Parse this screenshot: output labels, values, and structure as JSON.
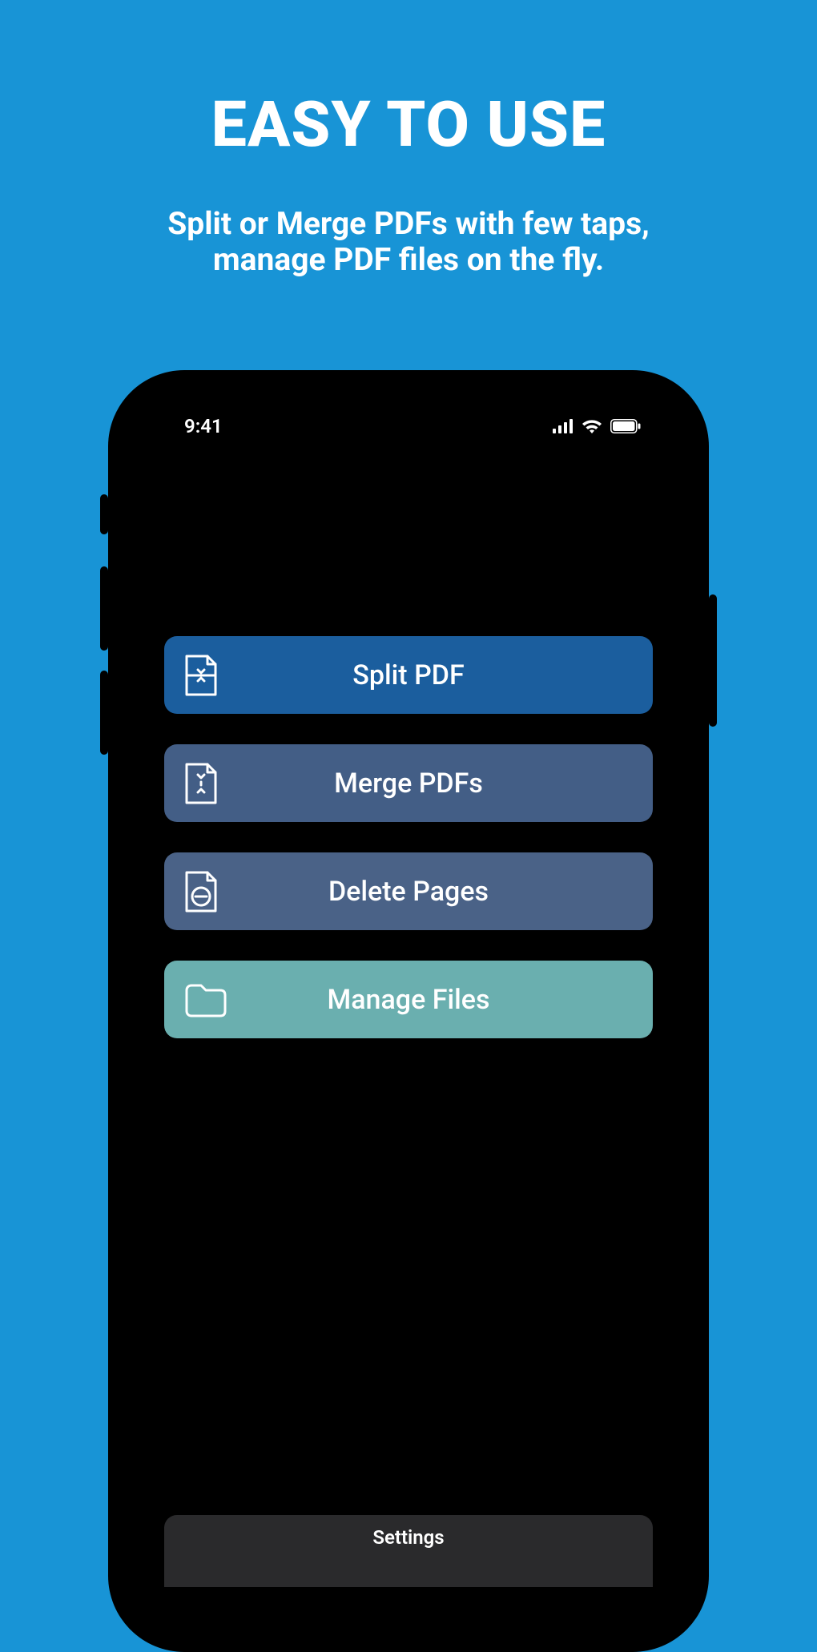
{
  "marketing": {
    "headline": "EASY TO USE",
    "subhead_line1": "Split or Merge PDFs with few taps,",
    "subhead_line2": "manage PDF files on the fly."
  },
  "status": {
    "time": "9:41"
  },
  "actions": [
    {
      "label": "Split PDF",
      "icon": "split-page-icon",
      "color": "#1b5e9e"
    },
    {
      "label": "Merge PDFs",
      "icon": "merge-page-icon",
      "color": "#435e86"
    },
    {
      "label": "Delete Pages",
      "icon": "delete-page-icon",
      "color": "#4a6287"
    },
    {
      "label": "Manage Files",
      "icon": "folder-icon",
      "color": "#6aafaf"
    }
  ],
  "bottom": {
    "settings_label": "Settings"
  }
}
